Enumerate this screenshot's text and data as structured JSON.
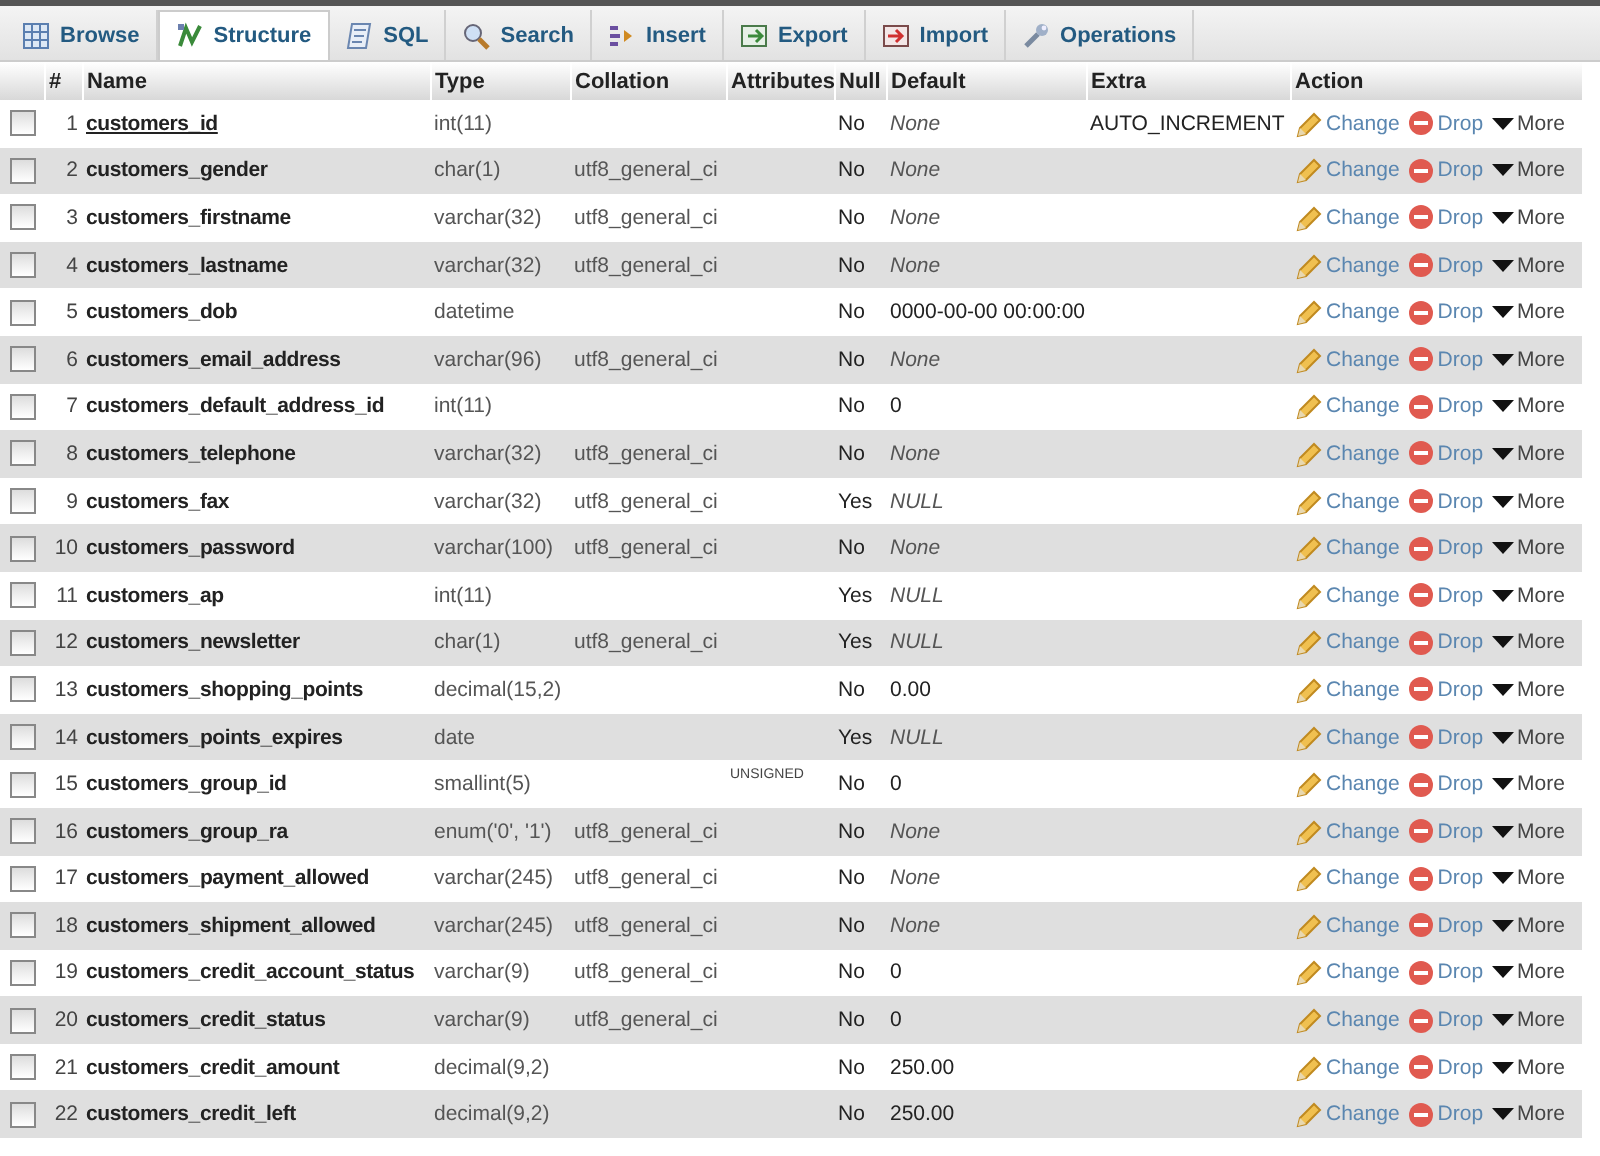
{
  "tabs": [
    {
      "label": "Browse",
      "selected": false
    },
    {
      "label": "Structure",
      "selected": true
    },
    {
      "label": "SQL",
      "selected": false
    },
    {
      "label": "Search",
      "selected": false
    },
    {
      "label": "Insert",
      "selected": false
    },
    {
      "label": "Export",
      "selected": false
    },
    {
      "label": "Import",
      "selected": false
    },
    {
      "label": "Operations",
      "selected": false
    }
  ],
  "table": {
    "columns": [
      "#",
      "Name",
      "Type",
      "Collation",
      "Attributes",
      "Null",
      "Default",
      "Extra",
      "Action"
    ],
    "rows": [
      {
        "num": "1",
        "name": "customers_id",
        "primary": true,
        "type": "int(11)",
        "collation": "",
        "attributes": "",
        "null": "No",
        "default": "None",
        "default_italic": true,
        "extra": "AUTO_INCREMENT",
        "checked": false,
        "actions": [
          "Change",
          "Drop",
          "More"
        ]
      },
      {
        "num": "2",
        "name": "customers_gender",
        "primary": false,
        "type": "char(1)",
        "collation": "utf8_general_ci",
        "attributes": "",
        "null": "No",
        "default": "None",
        "default_italic": true,
        "extra": "",
        "checked": false,
        "actions": [
          "Change",
          "Drop",
          "More"
        ]
      },
      {
        "num": "3",
        "name": "customers_firstname",
        "primary": false,
        "type": "varchar(32)",
        "collation": "utf8_general_ci",
        "attributes": "",
        "null": "No",
        "default": "None",
        "default_italic": true,
        "extra": "",
        "checked": false,
        "actions": [
          "Change",
          "Drop",
          "More"
        ]
      },
      {
        "num": "4",
        "name": "customers_lastname",
        "primary": false,
        "type": "varchar(32)",
        "collation": "utf8_general_ci",
        "attributes": "",
        "null": "No",
        "default": "None",
        "default_italic": true,
        "extra": "",
        "checked": false,
        "actions": [
          "Change",
          "Drop",
          "More"
        ]
      },
      {
        "num": "5",
        "name": "customers_dob",
        "primary": false,
        "type": "datetime",
        "collation": "",
        "attributes": "",
        "null": "No",
        "default": "0000-00-00 00:00:00",
        "default_italic": false,
        "extra": "",
        "checked": false,
        "actions": [
          "Change",
          "Drop",
          "More"
        ]
      },
      {
        "num": "6",
        "name": "customers_email_address",
        "primary": false,
        "type": "varchar(96)",
        "collation": "utf8_general_ci",
        "attributes": "",
        "null": "No",
        "default": "None",
        "default_italic": true,
        "extra": "",
        "checked": false,
        "actions": [
          "Change",
          "Drop",
          "More"
        ]
      },
      {
        "num": "7",
        "name": "customers_default_address_id",
        "primary": false,
        "type": "int(11)",
        "collation": "",
        "attributes": "",
        "null": "No",
        "default": "0",
        "default_italic": false,
        "extra": "",
        "checked": false,
        "actions": [
          "Change",
          "Drop",
          "More"
        ]
      },
      {
        "num": "8",
        "name": "customers_telephone",
        "primary": false,
        "type": "varchar(32)",
        "collation": "utf8_general_ci",
        "attributes": "",
        "null": "No",
        "default": "None",
        "default_italic": true,
        "extra": "",
        "checked": false,
        "actions": [
          "Change",
          "Drop",
          "More"
        ]
      },
      {
        "num": "9",
        "name": "customers_fax",
        "primary": false,
        "type": "varchar(32)",
        "collation": "utf8_general_ci",
        "attributes": "",
        "null": "Yes",
        "default": "NULL",
        "default_italic": true,
        "extra": "",
        "checked": false,
        "actions": [
          "Change",
          "Drop",
          "More"
        ]
      },
      {
        "num": "10",
        "name": "customers_password",
        "primary": false,
        "type": "varchar(100)",
        "collation": "utf8_general_ci",
        "attributes": "",
        "null": "No",
        "default": "None",
        "default_italic": true,
        "extra": "",
        "checked": false,
        "actions": [
          "Change",
          "Drop",
          "More"
        ]
      },
      {
        "num": "11",
        "name": "customers_ap",
        "primary": false,
        "type": "int(11)",
        "collation": "",
        "attributes": "",
        "null": "Yes",
        "default": "NULL",
        "default_italic": true,
        "extra": "",
        "checked": false,
        "actions": [
          "Change",
          "Drop",
          "More"
        ]
      },
      {
        "num": "12",
        "name": "customers_newsletter",
        "primary": false,
        "type": "char(1)",
        "collation": "utf8_general_ci",
        "attributes": "",
        "null": "Yes",
        "default": "NULL",
        "default_italic": true,
        "extra": "",
        "checked": false,
        "actions": [
          "Change",
          "Drop",
          "More"
        ]
      },
      {
        "num": "13",
        "name": "customers_shopping_points",
        "primary": false,
        "type": "decimal(15,2)",
        "collation": "",
        "attributes": "",
        "null": "No",
        "default": "0.00",
        "default_italic": false,
        "extra": "",
        "checked": false,
        "actions": [
          "Change",
          "Drop",
          "More"
        ]
      },
      {
        "num": "14",
        "name": "customers_points_expires",
        "primary": false,
        "type": "date",
        "collation": "",
        "attributes": "",
        "null": "Yes",
        "default": "NULL",
        "default_italic": true,
        "extra": "",
        "checked": false,
        "actions": [
          "Change",
          "Drop",
          "More"
        ]
      },
      {
        "num": "15",
        "name": "customers_group_id",
        "primary": false,
        "type": "smallint(5)",
        "collation": "",
        "attributes": "UNSIGNED",
        "null": "No",
        "default": "0",
        "default_italic": false,
        "extra": "",
        "checked": false,
        "actions": [
          "Change",
          "Drop",
          "More"
        ]
      },
      {
        "num": "16",
        "name": "customers_group_ra",
        "primary": false,
        "type": "enum('0', '1')",
        "collation": "utf8_general_ci",
        "attributes": "",
        "null": "No",
        "default": "None",
        "default_italic": true,
        "extra": "",
        "checked": false,
        "actions": [
          "Change",
          "Drop",
          "More"
        ]
      },
      {
        "num": "17",
        "name": "customers_payment_allowed",
        "primary": false,
        "type": "varchar(245)",
        "collation": "utf8_general_ci",
        "attributes": "",
        "null": "No",
        "default": "None",
        "default_italic": true,
        "extra": "",
        "checked": false,
        "actions": [
          "Change",
          "Drop",
          "More"
        ]
      },
      {
        "num": "18",
        "name": "customers_shipment_allowed",
        "primary": false,
        "type": "varchar(245)",
        "collation": "utf8_general_ci",
        "attributes": "",
        "null": "No",
        "default": "None",
        "default_italic": true,
        "extra": "",
        "checked": false,
        "actions": [
          "Change",
          "Drop",
          "More"
        ]
      },
      {
        "num": "19",
        "name": "customers_credit_account_status",
        "primary": false,
        "type": "varchar(9)",
        "collation": "utf8_general_ci",
        "attributes": "",
        "null": "No",
        "default": "0",
        "default_italic": false,
        "extra": "",
        "checked": false,
        "actions": [
          "Change",
          "Drop",
          "More"
        ]
      },
      {
        "num": "20",
        "name": "customers_credit_status",
        "primary": false,
        "type": "varchar(9)",
        "collation": "utf8_general_ci",
        "attributes": "",
        "null": "No",
        "default": "0",
        "default_italic": false,
        "extra": "",
        "checked": false,
        "actions": [
          "Change",
          "Drop",
          "More"
        ]
      },
      {
        "num": "21",
        "name": "customers_credit_amount",
        "primary": false,
        "type": "decimal(9,2)",
        "collation": "",
        "attributes": "",
        "null": "No",
        "default": "250.00",
        "default_italic": false,
        "extra": "",
        "checked": false,
        "actions": [
          "Change",
          "Drop",
          "More"
        ]
      },
      {
        "num": "22",
        "name": "customers_credit_left",
        "primary": false,
        "type": "decimal(9,2)",
        "collation": "",
        "attributes": "",
        "null": "No",
        "default": "250.00",
        "default_italic": false,
        "extra": "",
        "checked": false,
        "actions": [
          "Change",
          "Drop",
          "More"
        ]
      }
    ]
  }
}
